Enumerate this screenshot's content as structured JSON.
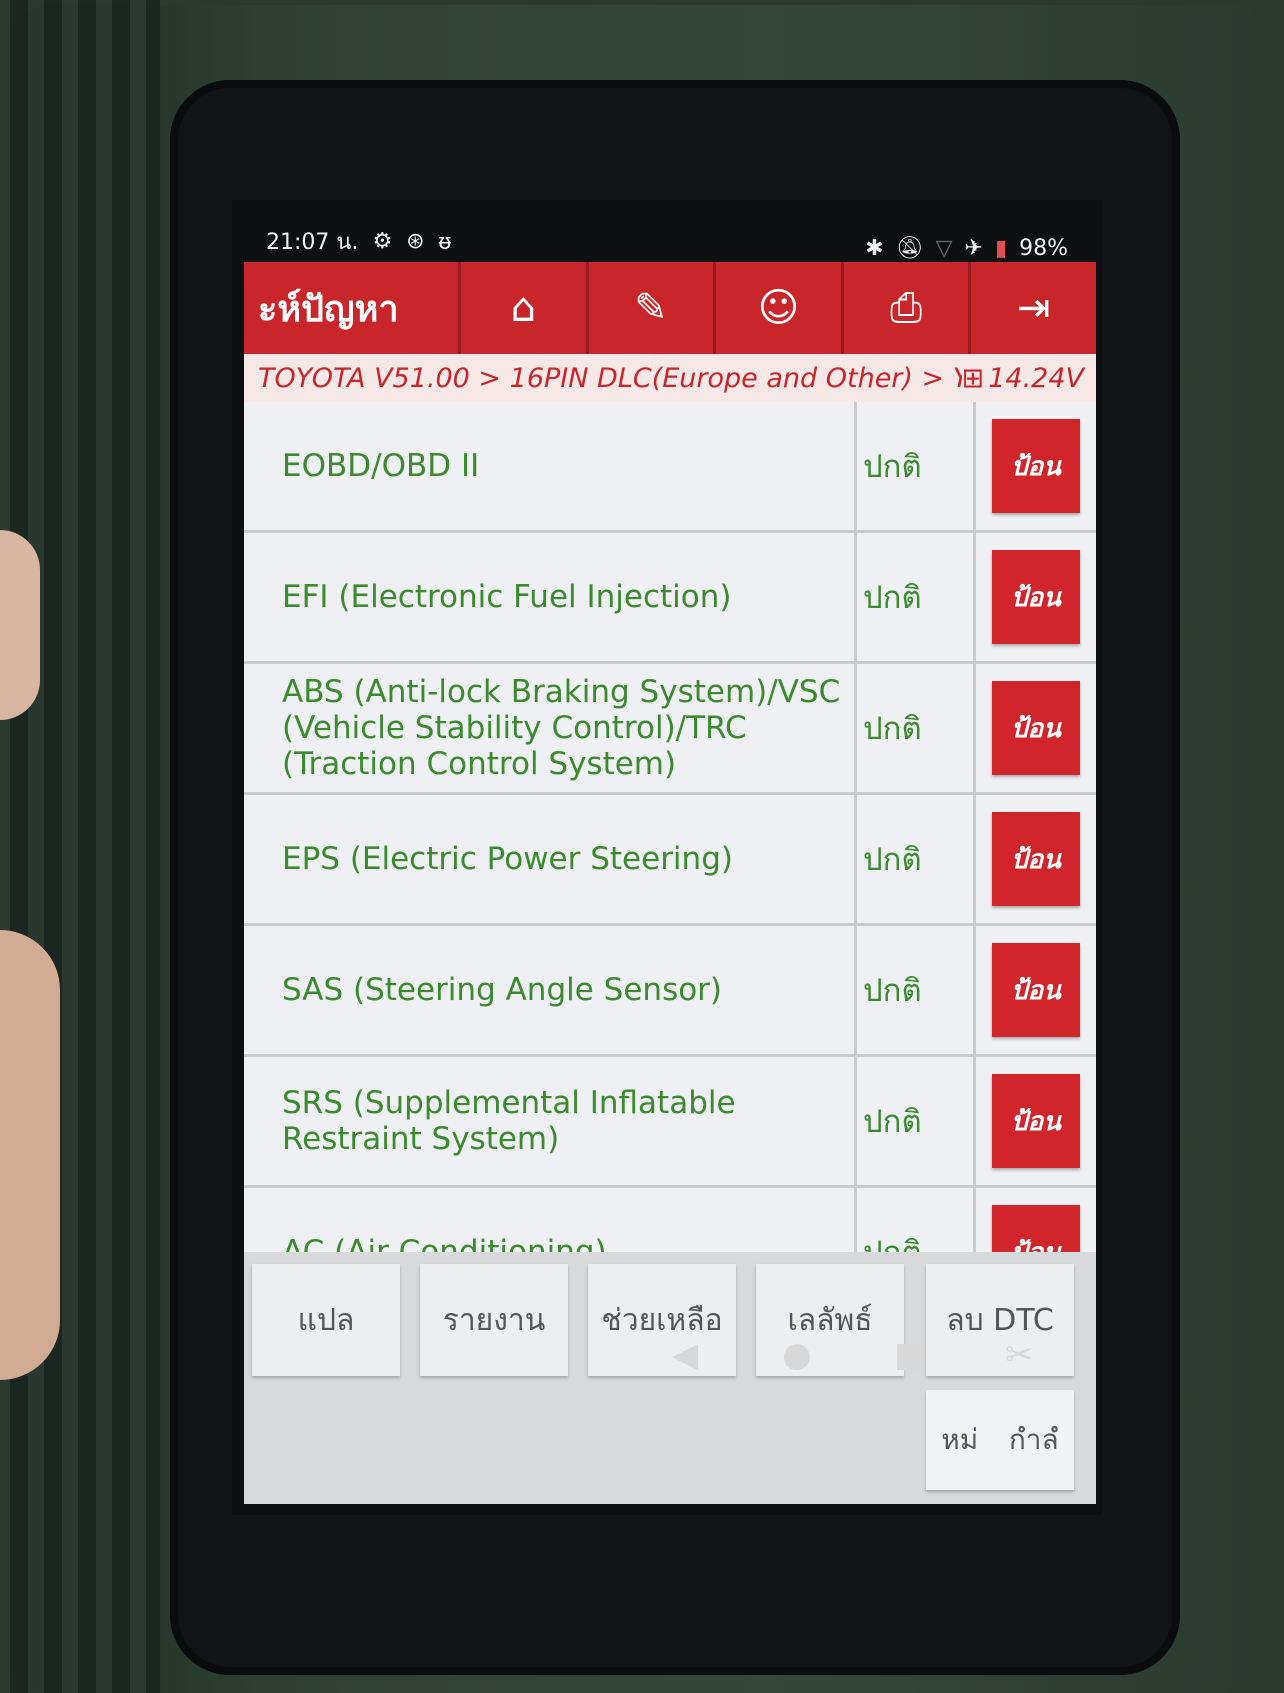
{
  "status_bar": {
    "time": "21:07 น.",
    "battery": "98%",
    "icons_left": [
      "gear-icon",
      "aperture-icon",
      "stethoscope-icon"
    ],
    "icons_right": [
      "bluetooth-icon",
      "mute-icon",
      "wifi-icon",
      "airplane-icon",
      "battery-icon"
    ]
  },
  "app_bar": {
    "title": "ะห์ปัญหา",
    "buttons": [
      "home-icon",
      "edit-icon",
      "support-icon",
      "print-icon",
      "exit-icon"
    ]
  },
  "breadcrumb": {
    "path": "TOYOTA V51.00 > 16PIN DLC(Europe and Other) > Y...",
    "voltage": "14.24V"
  },
  "systems": [
    {
      "name": "EOBD/OBD II",
      "status": "ปกติ",
      "action": "ป้อน"
    },
    {
      "name": "EFI (Electronic Fuel Injection)",
      "status": "ปกติ",
      "action": "ป้อน"
    },
    {
      "name": "ABS (Anti-lock Braking System)/VSC (Vehicle Stability Control)/TRC (Traction Control System)",
      "status": "ปกติ",
      "action": "ป้อน"
    },
    {
      "name": "EPS (Electric Power Steering)",
      "status": "ปกติ",
      "action": "ป้อน"
    },
    {
      "name": "SAS (Steering Angle Sensor)",
      "status": "ปกติ",
      "action": "ป้อน"
    },
    {
      "name": "SRS (Supplemental Inflatable Restraint System)",
      "status": "ปกติ",
      "action": "ป้อน"
    },
    {
      "name": "AC (Air Conditioning)",
      "status": "ปกติ",
      "action": "ป้อน"
    }
  ],
  "footer": {
    "translate": "แปล",
    "report": "รายงาน",
    "help": "ช่วยเหลือ",
    "zoom": "เลลัพธ์",
    "clear_dtc": "ลบ DTC",
    "mode_a": "หม่",
    "mode_b": "กำลํ"
  }
}
